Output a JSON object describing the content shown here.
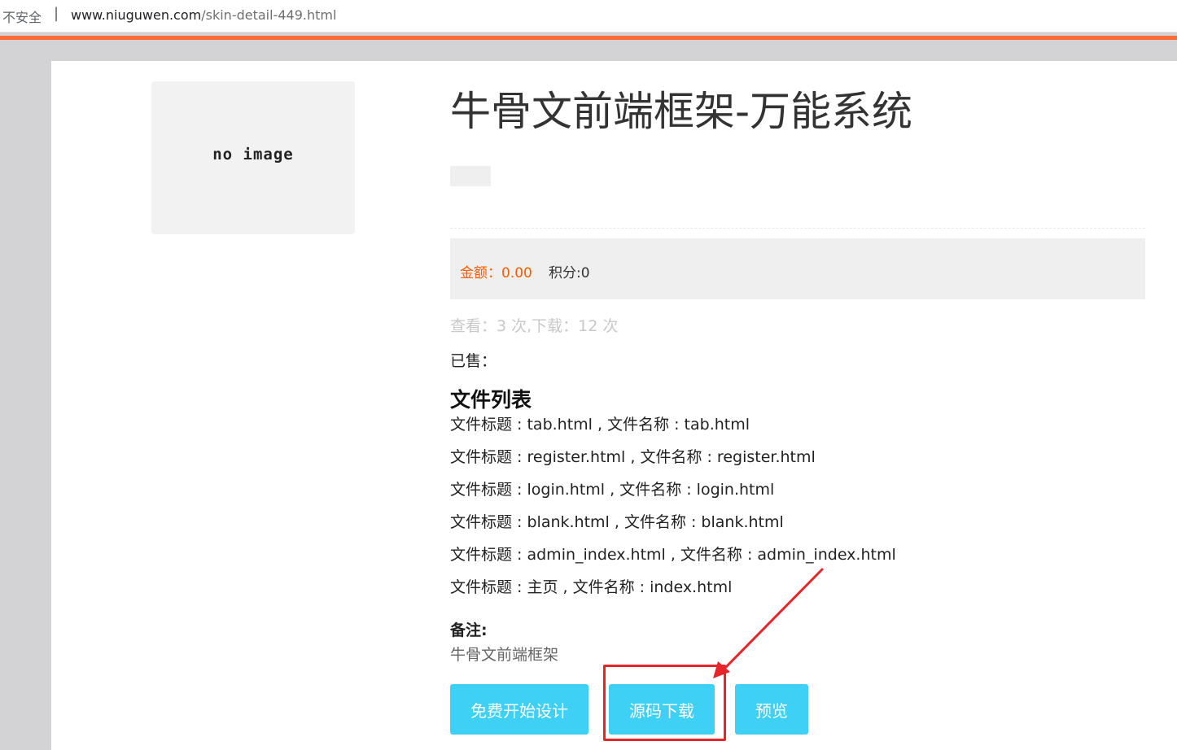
{
  "browser": {
    "security_label": "不安全",
    "separator": "|",
    "url_host": "www.niuguwen.com",
    "url_path": "/skin-detail-449.html"
  },
  "product": {
    "image_placeholder": "no image",
    "title": "牛骨文前端框架-万能系统",
    "price_label": "金额：0.00",
    "points_label": "积分:0",
    "stats": "查看：3 次,下载：12 次",
    "sold": "已售："
  },
  "files": {
    "heading": "文件列表",
    "items": [
      "文件标题 : tab.html , 文件名称 : tab.html",
      "文件标题 : register.html , 文件名称 : register.html",
      "文件标题 : login.html , 文件名称 : login.html",
      "文件标题 : blank.html , 文件名称 : blank.html",
      "文件标题 : admin_index.html , 文件名称 : admin_index.html",
      "文件标题 : 主页 , 文件名称 : index.html"
    ]
  },
  "remark": {
    "label": "备注:",
    "text": "牛骨文前端框架"
  },
  "actions": {
    "design_label": "免费开始设计",
    "download_label": "源码下载",
    "preview_label": "预览"
  },
  "colors": {
    "accent_orange": "#ff6b35",
    "price_orange": "#ff5a00",
    "button_blue": "#3fd0f6",
    "annotation_red": "#e8242b"
  }
}
